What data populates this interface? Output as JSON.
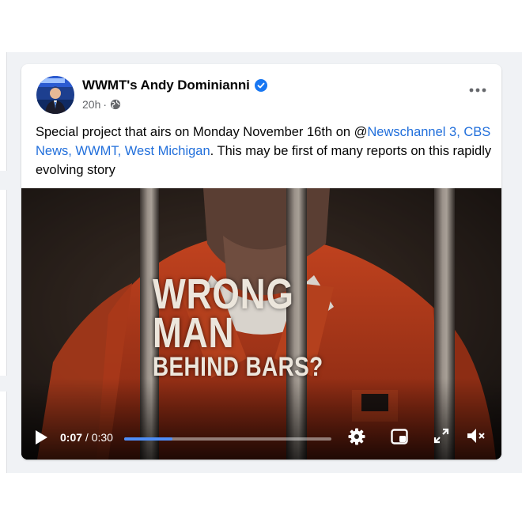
{
  "post": {
    "author": "WWMT's Andy Dominianni",
    "time": "20h",
    "caption_text_before": "Special project that airs on Monday November 16th on @",
    "caption_mention": "Newschannel 3, CBS News, WWMT, West Michigan",
    "caption_text_after": ". This may be first of many reports on this rapidly evolving story"
  },
  "video": {
    "headline_line1": "WRONG",
    "headline_line2": "MAN",
    "headline_line3": "BEHIND BARS?",
    "current_time": "0:07",
    "duration": "/ 0:30",
    "progress_fraction": 0.233
  },
  "icons": {
    "verified": "verified-badge-icon",
    "privacy": "globe-icon",
    "more": "more-options-icon",
    "play": "play-icon",
    "settings": "gear-icon",
    "pip": "picture-in-picture-icon",
    "fullscreen": "fullscreen-icon",
    "mute": "volume-muted-icon"
  },
  "colors": {
    "accent": "#216fdb",
    "verified": "#1877f2",
    "progress": "#4f8ef7",
    "jumpsuit": "#c2431f"
  }
}
